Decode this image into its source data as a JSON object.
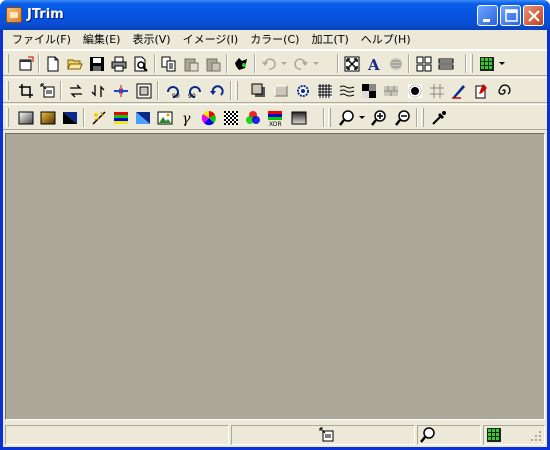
{
  "window": {
    "title": "JTrim",
    "accent_color": "#0a5ee9",
    "workspace_color": "#aca899"
  },
  "menubar": {
    "items": [
      {
        "label": "ファイル(F)"
      },
      {
        "label": "編集(E)"
      },
      {
        "label": "表示(V)"
      },
      {
        "label": "イメージ(I)"
      },
      {
        "label": "カラー(C)"
      },
      {
        "label": "加工(T)"
      },
      {
        "label": "ヘルプ(H)"
      }
    ]
  },
  "toolbar1": {
    "icons": [
      "capture-icon",
      "new-file-icon",
      "open-folder-icon",
      "save-icon",
      "print-icon",
      "print-preview-icon",
      "copy-icon",
      "paste-icon",
      "paste-new-icon",
      "glasses-icon",
      "undo-icon",
      "redo-icon",
      "fit-window-icon",
      "text-icon",
      "center-icon",
      "grid-view-icon",
      "strip-view-icon",
      "color-palette-icon"
    ]
  },
  "toolbar2": {
    "icons": [
      "crop-icon",
      "resize-icon",
      "flip-horizontal-icon",
      "flip-vertical-icon",
      "trim-margin-icon",
      "frame-icon",
      "rotate-left-90-icon",
      "rotate-right-90-icon",
      "rotate-free-icon",
      "shadow-icon",
      "emboss-icon",
      "sparkle-icon",
      "mosaic-icon",
      "wave-icon",
      "tile-icon",
      "brick-icon",
      "spot-icon",
      "focus-icon",
      "pen-icon",
      "paste-clip-icon",
      "spiral-icon"
    ]
  },
  "toolbar3": {
    "icons": [
      "grayscale-icon",
      "sepia-icon",
      "invert-icon",
      "brightness-icon",
      "color-balance-icon",
      "hue-icon",
      "image-icon",
      "gamma-icon",
      "color-wheel-icon",
      "noise-icon",
      "rgb-icon",
      "xor-icon",
      "gradient-icon",
      "zoom-menu-icon",
      "zoom-in-icon",
      "zoom-out-icon",
      "eyedropper-icon"
    ]
  },
  "statusbar": {
    "icons": [
      "resize-status-icon",
      "zoom-status-icon",
      "color-status-icon"
    ]
  }
}
